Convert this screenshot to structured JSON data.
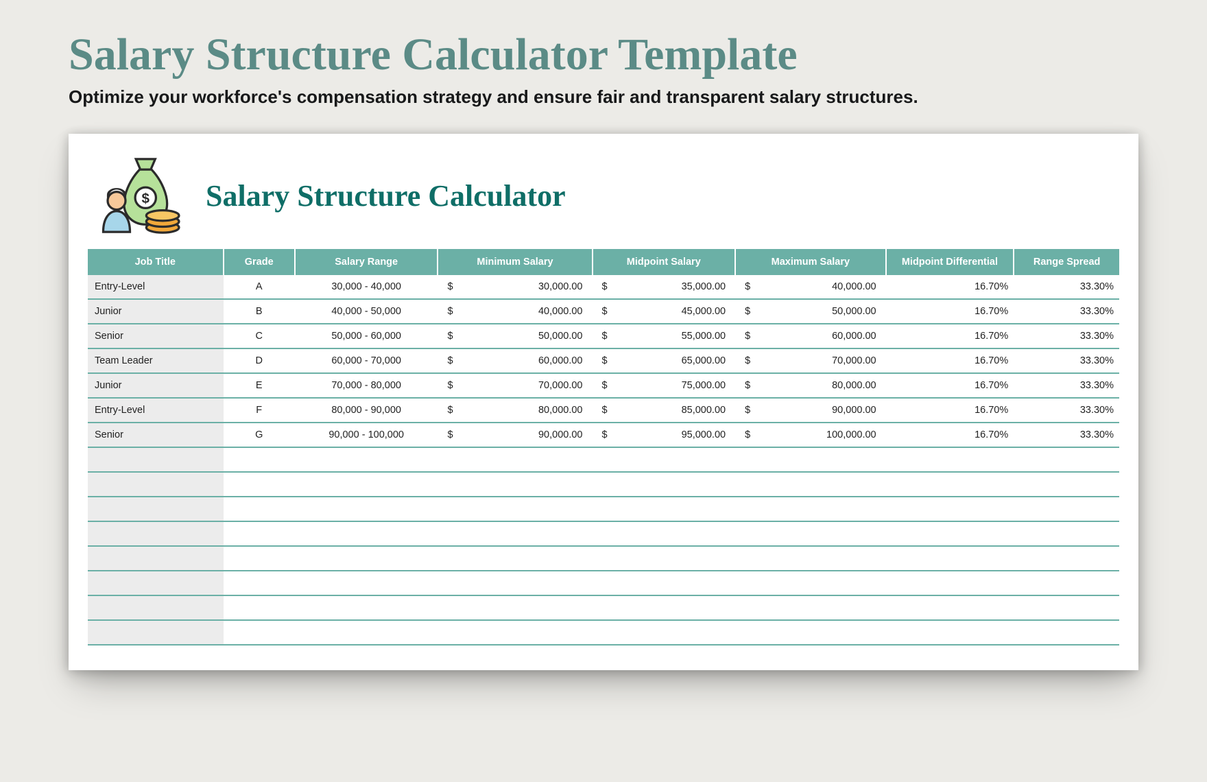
{
  "header": {
    "title": "Salary Structure Calculator Template",
    "subtitle": "Optimize your workforce's compensation strategy and ensure fair and transparent salary structures."
  },
  "sheet": {
    "title": "Salary Structure Calculator"
  },
  "columns": {
    "job": "Job Title",
    "grade": "Grade",
    "range": "Salary Range",
    "min": "Minimum Salary",
    "mid": "Midpoint Salary",
    "max": "Maximum Salary",
    "diff": "Midpoint Differential",
    "spread": "Range Spread"
  },
  "currency_symbol": "$",
  "rows": [
    {
      "job": "Entry-Level",
      "grade": "A",
      "range": "30,000 - 40,000",
      "min": "30,000.00",
      "mid": "35,000.00",
      "max": "40,000.00",
      "diff": "16.70%",
      "spread": "33.30%"
    },
    {
      "job": "Junior",
      "grade": "B",
      "range": "40,000 - 50,000",
      "min": "40,000.00",
      "mid": "45,000.00",
      "max": "50,000.00",
      "diff": "16.70%",
      "spread": "33.30%"
    },
    {
      "job": "Senior",
      "grade": "C",
      "range": "50,000 - 60,000",
      "min": "50,000.00",
      "mid": "55,000.00",
      "max": "60,000.00",
      "diff": "16.70%",
      "spread": "33.30%"
    },
    {
      "job": "Team Leader",
      "grade": "D",
      "range": "60,000 - 70,000",
      "min": "60,000.00",
      "mid": "65,000.00",
      "max": "70,000.00",
      "diff": "16.70%",
      "spread": "33.30%"
    },
    {
      "job": "Junior",
      "grade": "E",
      "range": "70,000 - 80,000",
      "min": "70,000.00",
      "mid": "75,000.00",
      "max": "80,000.00",
      "diff": "16.70%",
      "spread": "33.30%"
    },
    {
      "job": "Entry-Level",
      "grade": "F",
      "range": "80,000 - 90,000",
      "min": "80,000.00",
      "mid": "85,000.00",
      "max": "90,000.00",
      "diff": "16.70%",
      "spread": "33.30%"
    },
    {
      "job": "Senior",
      "grade": "G",
      "range": "90,000 - 100,000",
      "min": "90,000.00",
      "mid": "95,000.00",
      "max": "100,000.00",
      "diff": "16.70%",
      "spread": "33.30%"
    }
  ],
  "empty_row_count": 8
}
